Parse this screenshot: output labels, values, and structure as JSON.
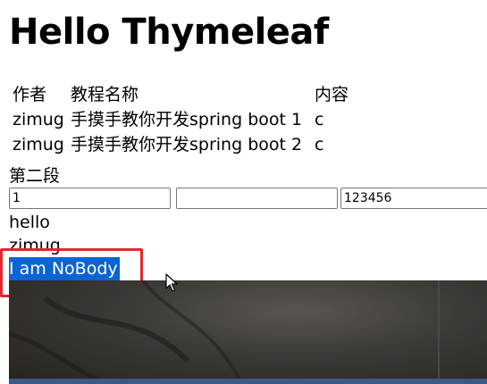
{
  "page_title": "Hello Thymeleaf",
  "table": {
    "headers": [
      "作者",
      "教程名称",
      "内容"
    ],
    "rows": [
      {
        "author": "zimug",
        "name": "手摸手教你开发spring boot 1",
        "content": "c"
      },
      {
        "author": "zimug",
        "name": "手摸手教你开发spring boot 2",
        "content": "c"
      }
    ]
  },
  "section_label": "第二段",
  "inputs": [
    {
      "value": "1",
      "placeholder": ""
    },
    {
      "value": "",
      "placeholder": ""
    },
    {
      "value": "123456",
      "placeholder": ""
    }
  ],
  "lines": {
    "hello": "hello",
    "name": "zimug",
    "nobody": "I am NoBody"
  },
  "colors": {
    "selection_highlight": "#0a64d4",
    "annotation_box": "#e0282e"
  },
  "icons": {
    "cursor": "mouse-pointer-icon"
  }
}
